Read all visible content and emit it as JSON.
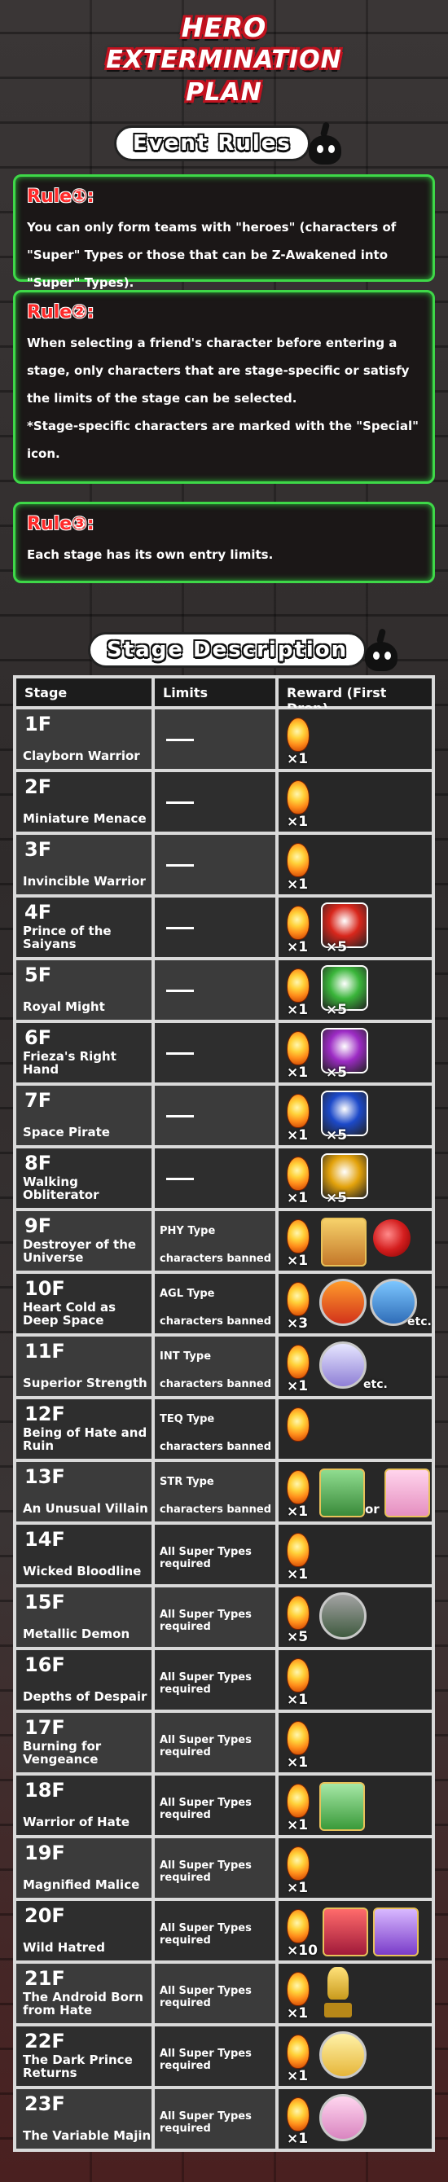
{
  "logo": {
    "line1": "HERO",
    "line2": "EXTERMINATION PLAN"
  },
  "rules_heading": "Event Rules",
  "rules": [
    {
      "title": "Rule①:",
      "text": "You can only form teams with \"heroes\" (characters of \"Super\" Types or those that can be Z-Awakened into \"Super\" Types)."
    },
    {
      "title": "Rule②:",
      "text": "When selecting a friend's character before entering a stage, only characters that are stage-specific or satisfy the limits of the stage can be selected.\n*Stage-specific characters are marked with the \"Special\" icon."
    },
    {
      "title": "Rule③:",
      "text": "Each stage has its own entry limits."
    }
  ],
  "stage_heading": "Stage Description",
  "table": {
    "headers": [
      "Stage",
      "Limits",
      "Reward (First Drop)"
    ],
    "rows": [
      {
        "floor": "1F",
        "name": "Clayborn Warrior",
        "limit": "",
        "stones": "×1",
        "extra": ""
      },
      {
        "floor": "2F",
        "name": "Miniature Menace",
        "limit": "",
        "stones": "×1",
        "extra": ""
      },
      {
        "floor": "3F",
        "name": "Invincible Warrior",
        "limit": "",
        "stones": "×1",
        "extra": ""
      },
      {
        "floor": "4F",
        "name": "Prince of the Saiyans",
        "limit": "",
        "stones": "×1",
        "extra": "medal-red",
        "extra_mult": "×5"
      },
      {
        "floor": "5F",
        "name": "Royal Might",
        "limit": "",
        "stones": "×1",
        "extra": "medal-green",
        "extra_mult": "×5"
      },
      {
        "floor": "6F",
        "name": "Frieza's Right Hand",
        "limit": "",
        "stones": "×1",
        "extra": "medal-purple",
        "extra_mult": "×5"
      },
      {
        "floor": "7F",
        "name": "Space Pirate",
        "limit": "",
        "stones": "×1",
        "extra": "medal-blue",
        "extra_mult": "×5"
      },
      {
        "floor": "8F",
        "name": "Walking Obliterator",
        "limit": "",
        "stones": "×1",
        "extra": "medal-gold",
        "extra_mult": "×5"
      },
      {
        "floor": "9F",
        "name": "Destroyer of the Universe",
        "limit": "PHY Type characters banned",
        "stones": "×1",
        "extra": "card-ball"
      },
      {
        "floor": "10F",
        "name": "Heart Cold as Deep Space",
        "limit": "AGL Type characters banned",
        "stones": "×3",
        "extra": "cards-etc",
        "etc": "etc."
      },
      {
        "floor": "11F",
        "name": "Superior Strength",
        "limit": "INT Type characters banned",
        "stones": "×1",
        "extra": "round-etc",
        "etc": "etc."
      },
      {
        "floor": "12F",
        "name": "Being of Hate and Ruin",
        "limit": "TEQ Type characters banned",
        "stones": "",
        "extra": ""
      },
      {
        "floor": "13F",
        "name": "An Unusual Villain",
        "limit": "STR Type characters banned",
        "stones": "×1",
        "extra": "card-or",
        "or": "or"
      },
      {
        "floor": "14F",
        "name": "Wicked Bloodline",
        "limit": "All Super Types required",
        "stones": "×1",
        "extra": ""
      },
      {
        "floor": "15F",
        "name": "Metallic Demon",
        "limit": "All Super Types required",
        "stones": "×5",
        "extra": "round"
      },
      {
        "floor": "16F",
        "name": "Depths of Despair",
        "limit": "All Super Types required",
        "stones": "×1",
        "extra": ""
      },
      {
        "floor": "17F",
        "name": "Burning for Vengeance",
        "limit": "All Super Types required",
        "stones": "×1",
        "extra": ""
      },
      {
        "floor": "18F",
        "name": "Warrior of Hate",
        "limit": "All Super Types required",
        "stones": "×1",
        "extra": "card-green"
      },
      {
        "floor": "19F",
        "name": "Magnified Malice",
        "limit": "All Super Types required",
        "stones": "×1",
        "extra": ""
      },
      {
        "floor": "20F",
        "name": "Wild Hatred",
        "limit": "All Super Types required",
        "stones": "×10",
        "extra": "two-cards"
      },
      {
        "floor": "21F",
        "name": "The Android Born from Hate",
        "limit": "All Super Types required",
        "stones": "×1",
        "extra": "trophy"
      },
      {
        "floor": "22F",
        "name": "The Dark Prince Returns",
        "limit": "All Super Types required",
        "stones": "×1",
        "extra": "round-gold"
      },
      {
        "floor": "23F",
        "name": "The Variable Majin",
        "limit": "All Super Types required",
        "stones": "×1",
        "extra": "round-pink"
      }
    ]
  },
  "icons": {
    "stone": "dragon-stone-icon",
    "mascot": "mascot-icon"
  }
}
